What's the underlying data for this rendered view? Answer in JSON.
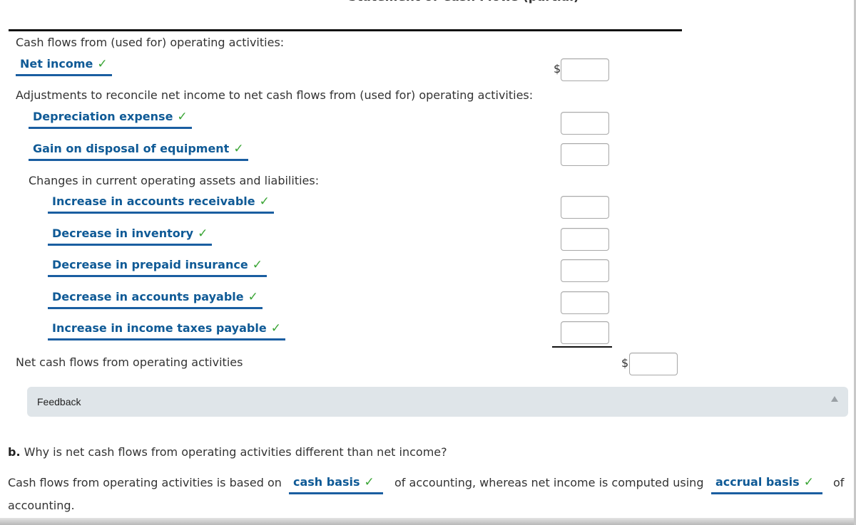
{
  "statement": {
    "title": "Statement of Cash Flows (partial)",
    "operating_header": "Cash flows from (used for) operating activities:",
    "net_income": {
      "label": "Net income",
      "check": "✓",
      "currency": "$",
      "value": ""
    },
    "adjustments_header": "Adjustments to reconcile net income to net cash flows from (used for) operating activities:",
    "adjustments": [
      {
        "label": "Depreciation expense",
        "check": "✓",
        "value": ""
      },
      {
        "label": "Gain on disposal of equipment",
        "check": "✓",
        "value": ""
      }
    ],
    "changes_header": "Changes in current operating assets and liabilities:",
    "changes": [
      {
        "label": "Increase in accounts receivable",
        "check": "✓",
        "value": ""
      },
      {
        "label": "Decrease in inventory",
        "check": "✓",
        "value": ""
      },
      {
        "label": "Decrease in prepaid insurance",
        "check": "✓",
        "value": ""
      },
      {
        "label": "Decrease in accounts payable",
        "check": "✓",
        "value": ""
      },
      {
        "label": "Increase in income taxes payable",
        "check": "✓",
        "value": ""
      }
    ],
    "net_cash": {
      "label": "Net cash flows from operating activities",
      "currency": "$",
      "value": ""
    }
  },
  "feedback": {
    "label": "Feedback",
    "toggle_icon": "▲"
  },
  "part_b": {
    "prefix": "b.",
    "question": " Why is net cash flows from operating activities different than net income?",
    "answer_part1": "Cash flows from operating activities is based on",
    "answer_select1": "cash basis",
    "answer_part2": "of accounting, whereas net income is computed using",
    "answer_select2": "accrual basis",
    "answer_part3": "of",
    "answer_part4": "accounting.",
    "check": "✓"
  },
  "colors": {
    "accent": "#0f5a96",
    "check": "#3aa535",
    "feedback_bg": "#dfe5e9"
  }
}
